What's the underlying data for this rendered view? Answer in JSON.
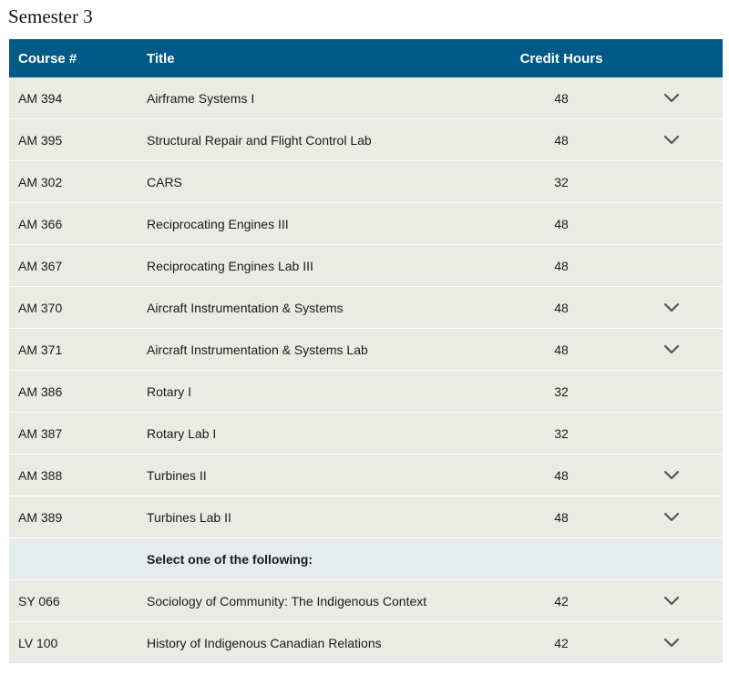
{
  "heading": "Semester 3",
  "table": {
    "headers": {
      "course_num": "Course #",
      "title": "Title",
      "credit_hours": "Credit Hours"
    },
    "rows": [
      {
        "course_num": "AM 394",
        "title": "Airframe Systems I",
        "hours": "48",
        "expandable": true
      },
      {
        "course_num": "AM 395",
        "title": "Structural Repair and Flight Control Lab",
        "hours": "48",
        "expandable": true
      },
      {
        "course_num": "AM 302",
        "title": "CARS",
        "hours": "32",
        "expandable": false
      },
      {
        "course_num": "AM 366",
        "title": "Reciprocating Engines III",
        "hours": "48",
        "expandable": false
      },
      {
        "course_num": "AM 367",
        "title": "Reciprocating Engines Lab III",
        "hours": "48",
        "expandable": false
      },
      {
        "course_num": "AM 370",
        "title": "Aircraft Instrumentation & Systems",
        "hours": "48",
        "expandable": true
      },
      {
        "course_num": "AM 371",
        "title": "Aircraft Instrumentation & Systems Lab",
        "hours": "48",
        "expandable": true
      },
      {
        "course_num": "AM 386",
        "title": "Rotary I",
        "hours": "32",
        "expandable": false
      },
      {
        "course_num": "AM 387",
        "title": "Rotary Lab I",
        "hours": "32",
        "expandable": false
      },
      {
        "course_num": "AM 388",
        "title": "Turbines II",
        "hours": "48",
        "expandable": true
      },
      {
        "course_num": "AM 389",
        "title": "Turbines Lab II",
        "hours": "48",
        "expandable": true
      }
    ],
    "elective_note": "Select one of the following:",
    "elective_rows": [
      {
        "course_num": "SY 066",
        "title": "Sociology of Community: The Indigenous Context",
        "hours": "42",
        "expandable": true
      },
      {
        "course_num": "LV 100",
        "title": "History of Indigenous Canadian Relations",
        "hours": "42",
        "expandable": true
      }
    ]
  },
  "colors": {
    "header_bg": "#005a87",
    "row_bg": "#ebebe5",
    "note_row_bg": "#e6ecee",
    "chevron": "#555555"
  },
  "icons": {
    "expand": "chevron-down-icon"
  }
}
